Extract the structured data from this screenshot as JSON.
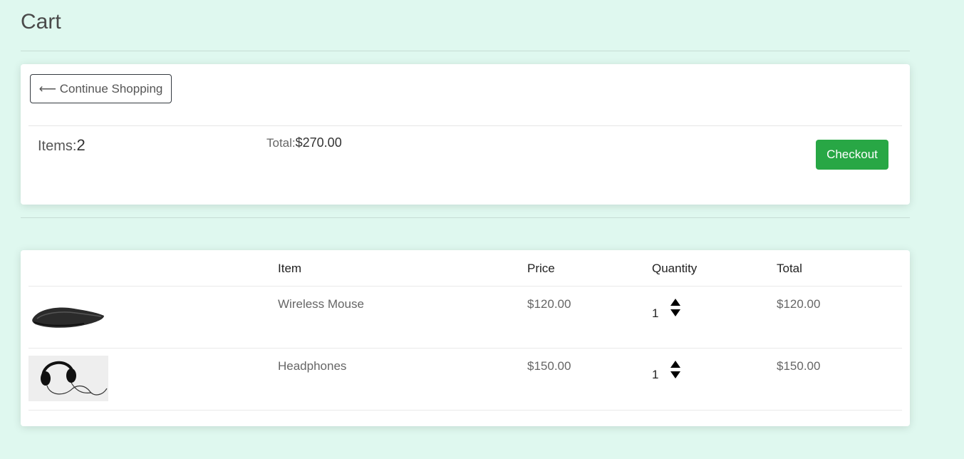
{
  "header": {
    "title": "Cart"
  },
  "summary": {
    "continue_label": "⟵ Continue Shopping",
    "items_label": "Items:",
    "items_count": "2",
    "total_label": "Total:",
    "total_value": "$270.00",
    "checkout_label": "Checkout"
  },
  "table": {
    "headers": [
      "Item",
      "Price",
      "Quantity",
      "Total"
    ],
    "rows": [
      {
        "image": "wireless-mouse-image",
        "item": "Wireless Mouse",
        "price": "$120.00",
        "quantity": "1",
        "total": "$120.00"
      },
      {
        "image": "headphones-image",
        "item": "Headphones",
        "price": "$150.00",
        "quantity": "1",
        "total": "$150.00"
      }
    ]
  },
  "colors": {
    "background": "#dff8ef",
    "checkout": "#28a745",
    "card": "#ffffff"
  }
}
